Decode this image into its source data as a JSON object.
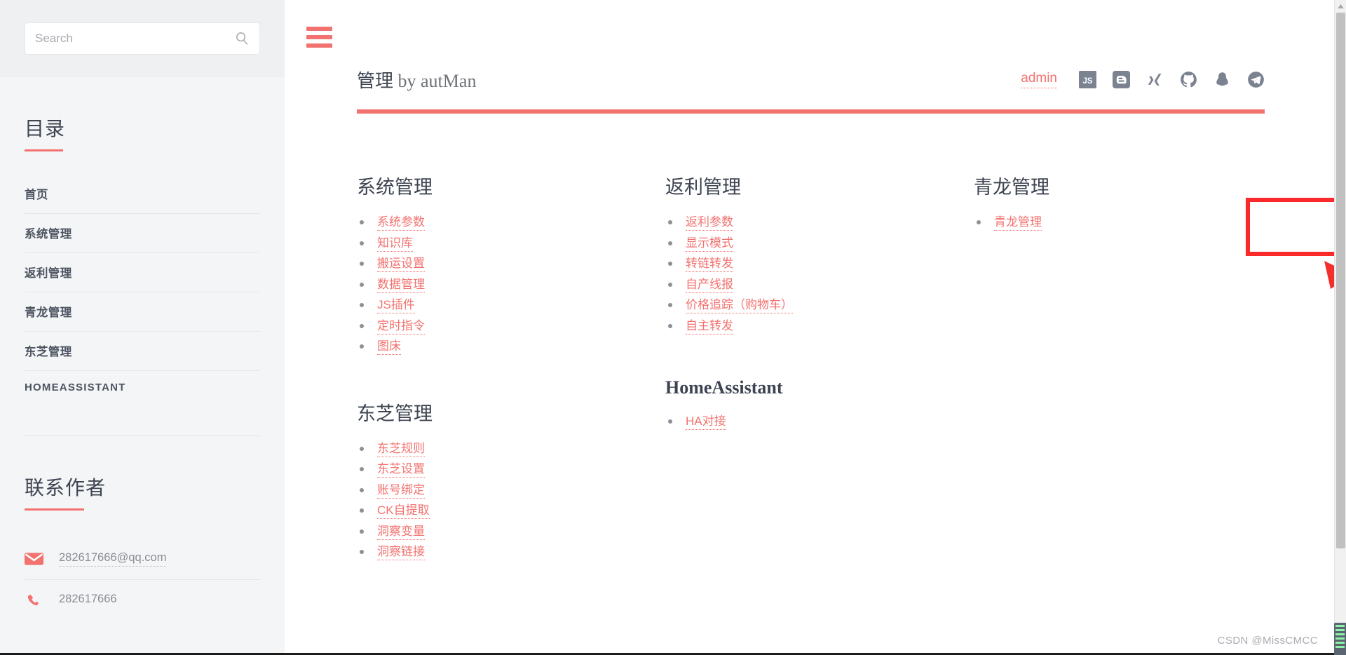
{
  "sidebar": {
    "search": {
      "placeholder": "Search",
      "value": "",
      "icon": "search-icon"
    },
    "catalog": {
      "title": "目录"
    },
    "nav_items": [
      {
        "label": "首页"
      },
      {
        "label": "系统管理"
      },
      {
        "label": "返利管理"
      },
      {
        "label": "青龙管理"
      },
      {
        "label": "东芝管理"
      },
      {
        "label": "HOMEASSISTANT"
      }
    ],
    "contact": {
      "title": "联系作者",
      "items": [
        {
          "icon": "envelope-icon",
          "text": "282617666@qq.com",
          "dotted": true
        },
        {
          "icon": "phone-icon",
          "text": "282617666",
          "dotted": false
        }
      ]
    }
  },
  "header": {
    "menu_icon": "hamburger-menu-icon",
    "title_cjk": "管理",
    "title_latin": " by autMan",
    "admin_label": "admin",
    "icons": [
      {
        "name": "js-icon",
        "label": "JS"
      },
      {
        "name": "blogger-icon",
        "label": "B"
      },
      {
        "name": "xing-icon",
        "label": "X"
      },
      {
        "name": "github-icon",
        "label": "GitHub"
      },
      {
        "name": "qq-icon",
        "label": "QQ"
      },
      {
        "name": "telegram-icon",
        "label": "Telegram"
      }
    ]
  },
  "main": {
    "columns": [
      {
        "groups": [
          {
            "title": "系统管理",
            "latin": false,
            "links": [
              {
                "label": "系统参数"
              },
              {
                "label": "知识库"
              },
              {
                "label": "搬运设置"
              },
              {
                "label": "数据管理"
              },
              {
                "label": "JS插件"
              },
              {
                "label": "定时指令"
              },
              {
                "label": "图床"
              }
            ]
          },
          {
            "title": "东芝管理",
            "latin": false,
            "links": [
              {
                "label": "东芝规则"
              },
              {
                "label": "东芝设置"
              },
              {
                "label": "账号绑定"
              },
              {
                "label": "CK自提取"
              },
              {
                "label": "洞察变量"
              },
              {
                "label": "洞察链接"
              }
            ]
          }
        ]
      },
      {
        "groups": [
          {
            "title": "返利管理",
            "latin": false,
            "links": [
              {
                "label": "返利参数"
              },
              {
                "label": "显示模式"
              },
              {
                "label": "转链转发"
              },
              {
                "label": "自产线报"
              },
              {
                "label": "价格追踪（购物车）"
              },
              {
                "label": "自主转发"
              }
            ]
          },
          {
            "title": "HomeAssistant",
            "latin": true,
            "links": [
              {
                "label": "HA对接"
              }
            ]
          }
        ]
      },
      {
        "groups": [
          {
            "title": "青龙管理",
            "latin": false,
            "links": [
              {
                "label": "青龙管理"
              }
            ]
          }
        ]
      }
    ]
  },
  "annotations": {
    "highlight_box": {
      "color": "#fa2a2a",
      "target": "青龙管理"
    },
    "arrow": {
      "color": "#f42d2d"
    }
  },
  "watermark": {
    "text": "CSDN @MissCMCC"
  },
  "colors": {
    "accent": "#f2726f",
    "sidebar_bg": "#f4f5f7",
    "search_bg": "#eff0f2",
    "heading": "#3d4451",
    "annotation_red": "#fa2a2a"
  }
}
